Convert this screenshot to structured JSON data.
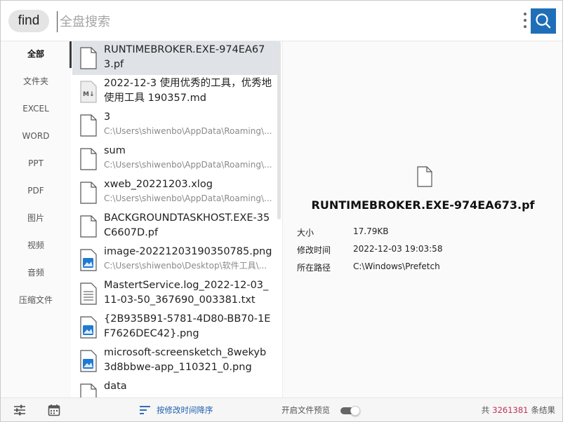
{
  "topbar": {
    "find_label": "find",
    "search_placeholder": "全盘搜索",
    "search_value": ""
  },
  "sidebar": {
    "items": [
      {
        "label": "全部",
        "active": true
      },
      {
        "label": "文件夹"
      },
      {
        "label": "EXCEL"
      },
      {
        "label": "WORD"
      },
      {
        "label": "PPT"
      },
      {
        "label": "PDF"
      },
      {
        "label": "图片"
      },
      {
        "label": "视频"
      },
      {
        "label": "音频"
      },
      {
        "label": "压缩文件"
      }
    ]
  },
  "results": [
    {
      "name": "RUNTIMEBROKER.EXE-974EA673.pf",
      "path": "",
      "icon": "file-icon",
      "selected": true
    },
    {
      "name": "2022-12-3 使用优秀的工具，优秀地使用工具 190357.md",
      "path": "",
      "icon": "markdown-file-icon"
    },
    {
      "name": "3",
      "path": "C:\\Users\\shiwenbo\\AppData\\Roaming\\...",
      "icon": "file-icon"
    },
    {
      "name": "sum",
      "path": "C:\\Users\\shiwenbo\\AppData\\Roaming\\...",
      "icon": "file-icon"
    },
    {
      "name": "xweb_20221203.xlog",
      "path": "C:\\Users\\shiwenbo\\AppData\\Roaming\\...",
      "icon": "file-icon"
    },
    {
      "name": "BACKGROUNDTASKHOST.EXE-35C6607D.pf",
      "path": "",
      "icon": "file-icon"
    },
    {
      "name": "image-20221203190350785.png",
      "path": "C:\\Users\\shiwenbo\\Desktop\\软件工具\\...",
      "icon": "image-file-icon"
    },
    {
      "name": "MastertService.log_2022-12-03_11-03-50_367690_003381.txt",
      "path": "",
      "icon": "text-file-icon"
    },
    {
      "name": "{2B935B91-5781-4D80-BB70-1EF7626DEC42}.png",
      "path": "",
      "icon": "image-file-icon"
    },
    {
      "name": "microsoft-screensketch_8wekyb3d8bbwe-app_110321_0.png",
      "path": "",
      "icon": "image-file-icon"
    },
    {
      "name": "data",
      "path": "",
      "icon": "file-icon"
    }
  ],
  "preview": {
    "title": "RUNTIMEBROKER.EXE-974EA673.pf",
    "size_label": "大小",
    "size_value": "17.79KB",
    "modified_label": "修改时间",
    "modified_value": "2022-12-03 19:03:58",
    "path_label": "所在路径",
    "path_value": "C:\\Windows\\Prefetch"
  },
  "bottombar": {
    "sort_label": "按修改时间降序",
    "preview_toggle_label": "开启文件预览",
    "preview_enabled": true,
    "count_prefix": "共",
    "count_value": "3261381",
    "count_suffix": "条结果"
  },
  "colors": {
    "accent": "#1f6fb8",
    "count_highlight": "#c0305a",
    "selected_row": "#dfe3e8"
  }
}
